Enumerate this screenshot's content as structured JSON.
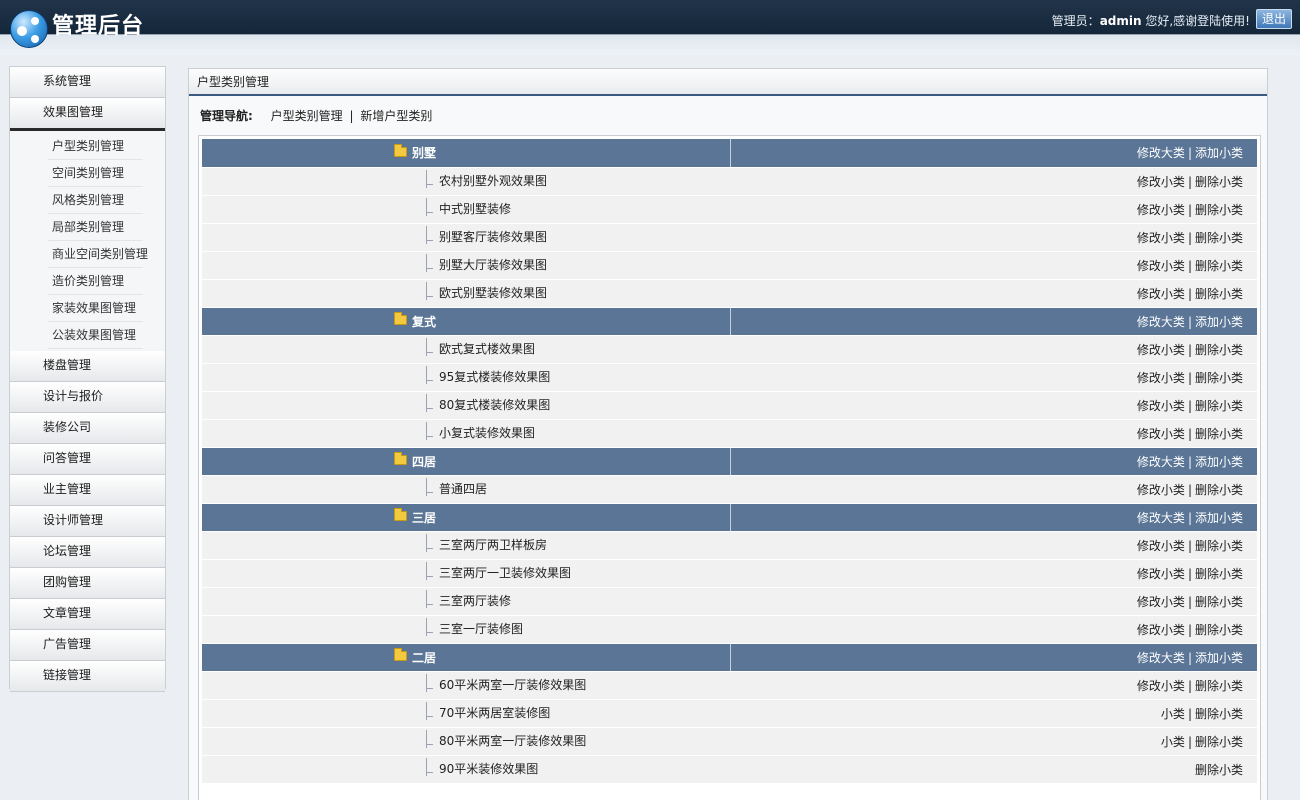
{
  "header": {
    "title": "管理后台",
    "user_label": "管理员：",
    "user_name": "admin",
    "welcome": " 您好,感谢登陆使用!",
    "logout": "退出"
  },
  "sidebar": {
    "top_item": "系统管理",
    "active_item": "效果图管理",
    "sub_items": [
      "户型类别管理",
      "空间类别管理",
      "风格类别管理",
      "局部类别管理",
      "商业空间类别管理",
      "造价类别管理",
      "家装效果图管理",
      "公装效果图管理"
    ],
    "items": [
      "楼盘管理",
      "设计与报价",
      "装修公司",
      "问答管理",
      "业主管理",
      "设计师管理",
      "论坛管理",
      "团购管理",
      "文章管理",
      "广告管理",
      "链接管理"
    ]
  },
  "main": {
    "title": "户型类别管理",
    "nav_label": "管理导航:",
    "nav_links": [
      "户型类别管理",
      "新增户型类别"
    ],
    "nav_sep": "|",
    "cat_ops": [
      "修改大类",
      "添加小类"
    ],
    "sub_ops": [
      "修改小类",
      "删除小类"
    ],
    "partial_ops": [
      "小类",
      "删除小类"
    ],
    "op_sep": "|",
    "categories": [
      {
        "name": "别墅",
        "subs": [
          "农村别墅外观效果图",
          "中式别墅装修",
          "别墅客厅装修效果图",
          "别墅大厅装修效果图",
          "欧式别墅装修效果图"
        ]
      },
      {
        "name": "复式",
        "subs": [
          "欧式复式楼效果图",
          "95复式楼装修效果图",
          "80复式楼装修效果图",
          "小复式装修效果图"
        ]
      },
      {
        "name": "四居",
        "subs": [
          "普通四居"
        ]
      },
      {
        "name": "三居",
        "subs": [
          "三室两厅两卫样板房",
          "三室两厅一卫装修效果图",
          "三室两厅装修",
          "三室一厅装修图"
        ]
      },
      {
        "name": "二居",
        "subs": [
          "60平米两室一厅装修效果图",
          "70平米两居室装修图",
          "80平米两室一厅装修效果图",
          "90平米装修效果图"
        ]
      }
    ]
  }
}
